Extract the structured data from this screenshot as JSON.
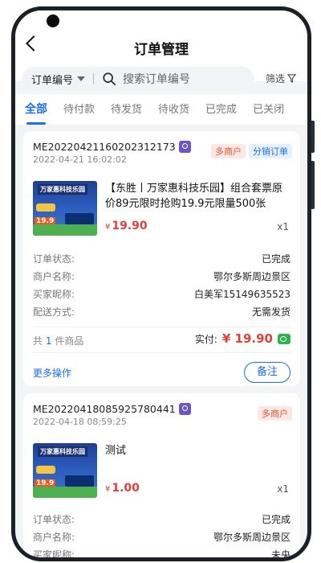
{
  "header": {
    "title": "订单管理"
  },
  "search": {
    "field_select": "订单编号",
    "placeholder": "搜索订单编号",
    "filter_label": "筛选"
  },
  "tabs": [
    {
      "label": "全部",
      "active": true
    },
    {
      "label": "待付款"
    },
    {
      "label": "待发货"
    },
    {
      "label": "待收货"
    },
    {
      "label": "已完成"
    },
    {
      "label": "已关闭"
    }
  ],
  "orders": [
    {
      "order_no": "ME20220421160202312173",
      "date": "2022-04-21 16:02:02",
      "badges": [
        "多商户",
        "分销订单"
      ],
      "thumb_title": "万家惠科技乐园",
      "thumb_price": "19.9",
      "product_name": "【东胜丨万家惠科技乐园】组合套票原价89元限时抢购19.9元限量500张",
      "price_currency": "¥",
      "price": "19.90",
      "qty": "x1",
      "fields": [
        {
          "k": "订单状态:",
          "v": "已完成"
        },
        {
          "k": "商户名称:",
          "v": "鄂尔多斯周边景区"
        },
        {
          "k": "买家昵称:",
          "v": "白美军15149635523"
        },
        {
          "k": "配送方式:",
          "v": "无需发货"
        }
      ],
      "summary_prefix": "共",
      "summary_count": "1",
      "summary_suffix": "件商品",
      "total_label": "实付:",
      "total_amount": "¥ 19.90",
      "more_ops": "更多操作",
      "note_button": "备注"
    },
    {
      "order_no": "ME20220418085925780441",
      "date": "2022-04-18 08:59:25",
      "badges": [
        "多商户"
      ],
      "thumb_title": "万家惠科技乐园",
      "thumb_price": "19.9",
      "product_name": "测试",
      "price_currency": "¥",
      "price": "1.00",
      "qty": "x1",
      "fields": [
        {
          "k": "订单状态:",
          "v": "已完成"
        },
        {
          "k": "商户名称:",
          "v": "鄂尔多斯周边景区"
        },
        {
          "k": "买家昵称:",
          "v": "未央"
        }
      ]
    }
  ],
  "colors": {
    "accent": "#1e6ff0",
    "price": "#e0403a",
    "merchant_badge": "#e45a3a"
  }
}
